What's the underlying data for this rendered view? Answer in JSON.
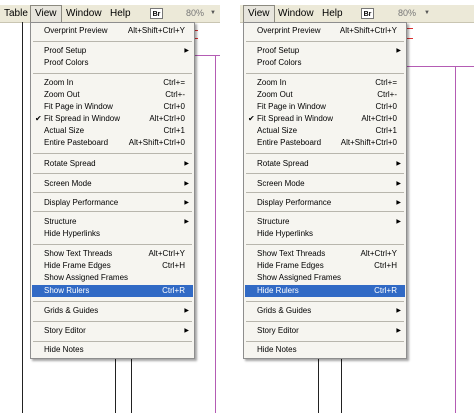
{
  "left_panel": {
    "menubar": {
      "items": [
        {
          "label": "Table"
        },
        {
          "label": "View"
        },
        {
          "label": "Window"
        },
        {
          "label": "Help"
        }
      ],
      "bridge_icon": "Br",
      "zoom": "80%"
    },
    "menu": {
      "items": [
        {
          "label": "Overprint Preview",
          "shortcut": "Alt+Shift+Ctrl+Y"
        },
        {
          "label": "Proof Setup",
          "shortcut": ""
        },
        {
          "label": "Proof Colors",
          "shortcut": ""
        },
        {
          "label": "Zoom In",
          "shortcut": "Ctrl+="
        },
        {
          "label": "Zoom Out",
          "shortcut": "Ctrl+-"
        },
        {
          "label": "Fit Page in Window",
          "shortcut": "Ctrl+0"
        },
        {
          "label": "Fit Spread in Window",
          "shortcut": "Alt+Ctrl+0",
          "checked": true
        },
        {
          "label": "Actual Size",
          "shortcut": "Ctrl+1"
        },
        {
          "label": "Entire Pasteboard",
          "shortcut": "Alt+Shift+Ctrl+0"
        },
        {
          "label": "Rotate Spread",
          "shortcut": ""
        },
        {
          "label": "Screen Mode",
          "shortcut": ""
        },
        {
          "label": "Display Performance",
          "shortcut": ""
        },
        {
          "label": "Structure",
          "shortcut": ""
        },
        {
          "label": "Hide Hyperlinks",
          "shortcut": ""
        },
        {
          "label": "Show Text Threads",
          "shortcut": "Alt+Ctrl+Y"
        },
        {
          "label": "Hide Frame Edges",
          "shortcut": "Ctrl+H"
        },
        {
          "label": "Show Assigned Frames",
          "shortcut": ""
        },
        {
          "label": "Show Rulers",
          "shortcut": "Ctrl+R",
          "highlighted": true
        },
        {
          "label": "Grids & Guides",
          "shortcut": ""
        },
        {
          "label": "Story Editor",
          "shortcut": ""
        },
        {
          "label": "Hide Notes",
          "shortcut": ""
        }
      ]
    }
  },
  "right_panel": {
    "menubar": {
      "items": [
        {
          "label": "View"
        },
        {
          "label": "Window"
        },
        {
          "label": "Help"
        }
      ],
      "bridge_icon": "Br",
      "zoom": "80%"
    },
    "menu": {
      "items": [
        {
          "label": "Overprint Preview",
          "shortcut": "Alt+Shift+Ctrl+Y"
        },
        {
          "label": "Proof Setup",
          "shortcut": ""
        },
        {
          "label": "Proof Colors",
          "shortcut": ""
        },
        {
          "label": "Zoom In",
          "shortcut": "Ctrl+="
        },
        {
          "label": "Zoom Out",
          "shortcut": "Ctrl+-"
        },
        {
          "label": "Fit Page in Window",
          "shortcut": "Ctrl+0"
        },
        {
          "label": "Fit Spread in Window",
          "shortcut": "Alt+Ctrl+0",
          "checked": true
        },
        {
          "label": "Actual Size",
          "shortcut": "Ctrl+1"
        },
        {
          "label": "Entire Pasteboard",
          "shortcut": "Alt+Shift+Ctrl+0"
        },
        {
          "label": "Rotate Spread",
          "shortcut": ""
        },
        {
          "label": "Screen Mode",
          "shortcut": ""
        },
        {
          "label": "Display Performance",
          "shortcut": ""
        },
        {
          "label": "Structure",
          "shortcut": ""
        },
        {
          "label": "Hide Hyperlinks",
          "shortcut": ""
        },
        {
          "label": "Show Text Threads",
          "shortcut": "Alt+Ctrl+Y"
        },
        {
          "label": "Hide Frame Edges",
          "shortcut": "Ctrl+H"
        },
        {
          "label": "Show Assigned Frames",
          "shortcut": ""
        },
        {
          "label": "Hide Rulers",
          "shortcut": "Ctrl+R",
          "highlighted": true
        },
        {
          "label": "Grids & Guides",
          "shortcut": ""
        },
        {
          "label": "Story Editor",
          "shortcut": ""
        },
        {
          "label": "Hide Notes",
          "shortcut": ""
        }
      ]
    }
  },
  "icons": {
    "submenu_arrow": "submenu-arrow-icon",
    "checkmark": "checkmark-icon",
    "dropdown": "dropdown-arrow-icon"
  },
  "colors": {
    "highlight": "#316ac5",
    "guide": "#b45cb4",
    "menubar_bg": "#ece9d8"
  }
}
